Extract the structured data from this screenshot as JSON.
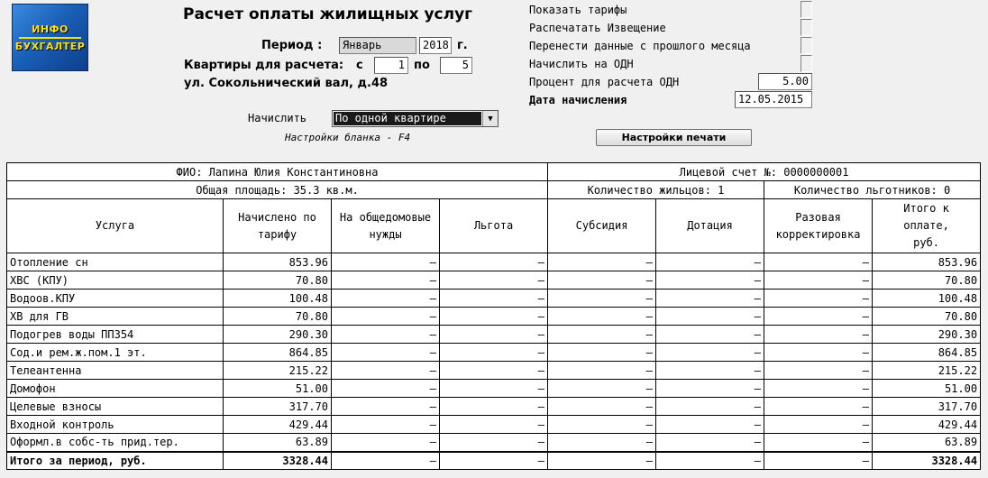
{
  "logo": {
    "line1": "ИНФО",
    "line2": "БУХГАЛТЕР"
  },
  "title": "Расчет оплаты жилищных услуг",
  "period": {
    "label": "Период :",
    "month": "Январь",
    "year": "2018",
    "year_suffix": "г."
  },
  "apartments": {
    "label": "Квартиры для расчета:",
    "from_label": "с",
    "from": "1",
    "to_label": "по",
    "to": "5"
  },
  "address": "ул. Сокольнический вал, д.48",
  "calc": {
    "label": "Начислить",
    "value": "По одной квартире",
    "settings_hint": "Настройки бланка - F4"
  },
  "print_settings_button": "Настройки печати",
  "options": {
    "show_tariffs": "Показать тарифы",
    "print_notice": "Распечатать Извещение",
    "carry_data": "Перенести данные с прошлого месяца",
    "charge_odn": "Начислить на ОДН",
    "odn_percent_label": "Процент для расчета ОДН",
    "odn_percent": "5.00",
    "charge_date_label": "Дата начисления",
    "charge_date": "12.05.2015"
  },
  "info": {
    "fio": "ФИО:   Лапина Юлия Константиновна",
    "account": "Лицевой счет №: 0000000001",
    "area": "Общая площадь: 35.3 кв.м.",
    "residents": "Количество жильцов: 1",
    "beneficiaries": "Количество льготников: 0"
  },
  "columns": {
    "service": "Услуга",
    "tariff": [
      "Начислено по",
      "тарифу"
    ],
    "common": [
      "На общедомовые",
      "нужды"
    ],
    "benefit": "Льгота",
    "subsidy": "Субсидия",
    "grant": "Дотация",
    "correction": [
      "Разовая",
      "корректировка"
    ],
    "total": [
      "Итого к",
      "оплате,",
      "руб."
    ]
  },
  "rows": [
    {
      "service": "Отопление сн",
      "tariff": "853.96",
      "common": "–",
      "benefit": "–",
      "subsidy": "–",
      "grant": "–",
      "correction": "–",
      "total": "853.96"
    },
    {
      "service": "ХВС (КПУ)",
      "tariff": "70.80",
      "common": "–",
      "benefit": "–",
      "subsidy": "–",
      "grant": "–",
      "correction": "–",
      "total": "70.80"
    },
    {
      "service": "Водоов.КПУ",
      "tariff": "100.48",
      "common": "–",
      "benefit": "–",
      "subsidy": "–",
      "grant": "–",
      "correction": "–",
      "total": "100.48"
    },
    {
      "service": "ХВ для ГВ",
      "tariff": "70.80",
      "common": "–",
      "benefit": "–",
      "subsidy": "–",
      "grant": "–",
      "correction": "–",
      "total": "70.80"
    },
    {
      "service": "Подогрев воды ПП354",
      "tariff": "290.30",
      "common": "–",
      "benefit": "–",
      "subsidy": "–",
      "grant": "–",
      "correction": "–",
      "total": "290.30"
    },
    {
      "service": "Сод.и рем.ж.пом.1 эт.",
      "tariff": "864.85",
      "common": "–",
      "benefit": "–",
      "subsidy": "–",
      "grant": "–",
      "correction": "–",
      "total": "864.85"
    },
    {
      "service": "Телеантенна",
      "tariff": "215.22",
      "common": "–",
      "benefit": "–",
      "subsidy": "–",
      "grant": "–",
      "correction": "–",
      "total": "215.22"
    },
    {
      "service": "Домофон",
      "tariff": "51.00",
      "common": "–",
      "benefit": "–",
      "subsidy": "–",
      "grant": "–",
      "correction": "–",
      "total": "51.00"
    },
    {
      "service": "Целевые взносы",
      "tariff": "317.70",
      "common": "–",
      "benefit": "–",
      "subsidy": "–",
      "grant": "–",
      "correction": "–",
      "total": "317.70"
    },
    {
      "service": "Входной контроль",
      "tariff": "429.44",
      "common": "–",
      "benefit": "–",
      "subsidy": "–",
      "grant": "–",
      "correction": "–",
      "total": "429.44"
    },
    {
      "service": "Оформл.в собс-ть прид.тер.",
      "tariff": "63.89",
      "common": "–",
      "benefit": "–",
      "subsidy": "–",
      "grant": "–",
      "correction": "–",
      "total": "63.89"
    }
  ],
  "totals": {
    "service": "Итого за период, руб.",
    "tariff": "3328.44",
    "common": "–",
    "benefit": "–",
    "subsidy": "–",
    "grant": "–",
    "correction": "–",
    "total": "3328.44"
  }
}
